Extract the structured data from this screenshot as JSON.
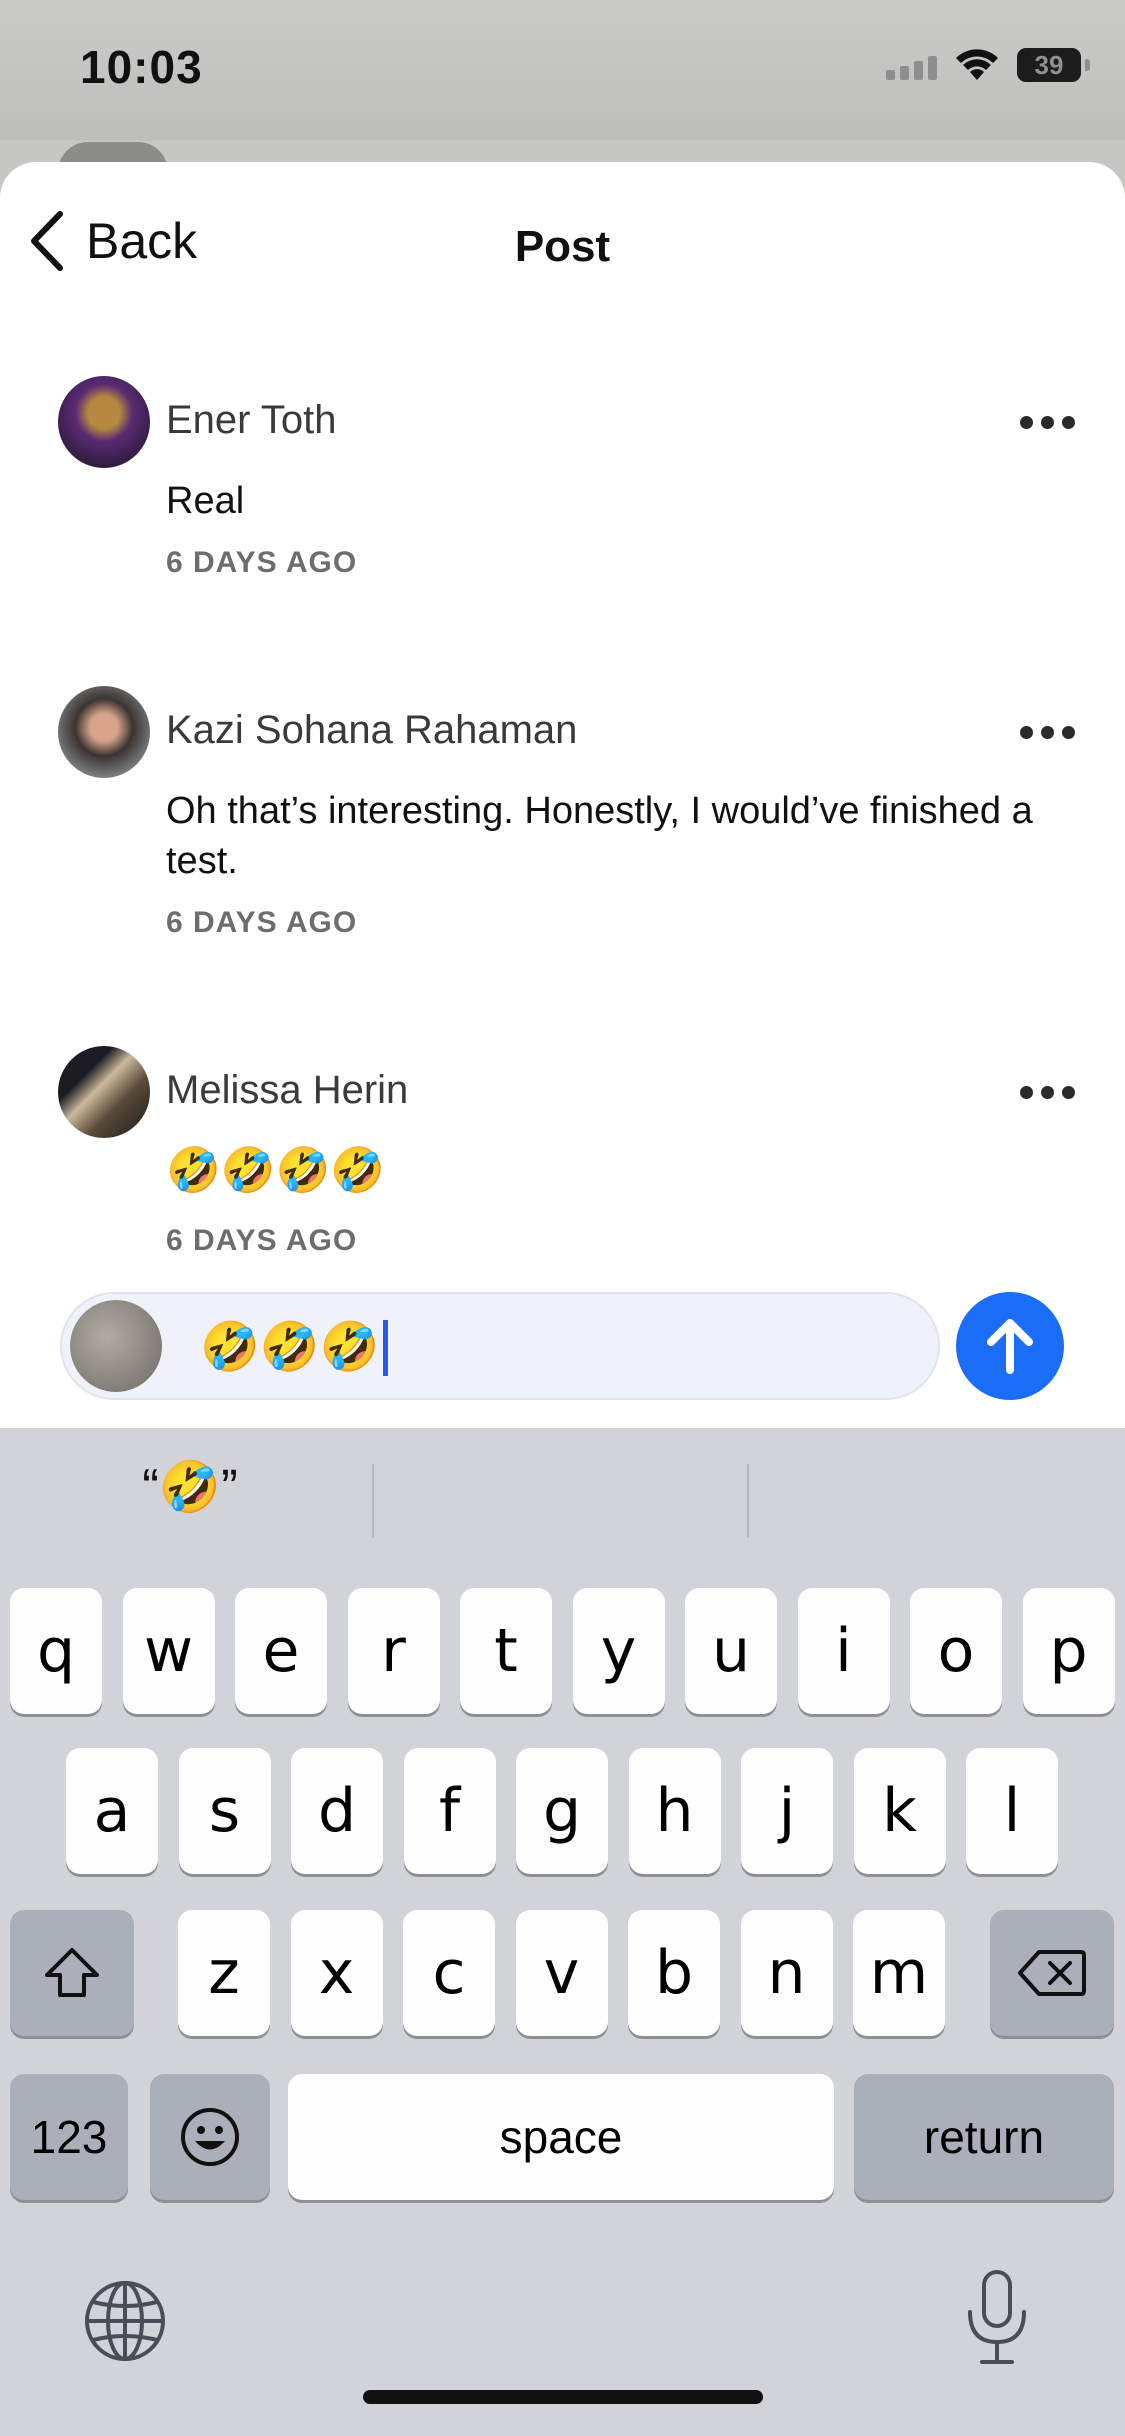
{
  "status_bar": {
    "time": "10:03",
    "battery": "39"
  },
  "nav": {
    "back_label": "Back",
    "title": "Post"
  },
  "comments": [
    {
      "author": "Ener Toth",
      "body": "Real",
      "time": "6 DAYS AGO"
    },
    {
      "author": "Kazi Sohana Rahaman",
      "body": "Oh that’s interesting. Honestly, I would’ve finished a test.",
      "time": "6 DAYS AGO"
    },
    {
      "author": "Melissa Herin",
      "body": "🤣🤣🤣🤣",
      "time": "6 DAYS AGO"
    }
  ],
  "composer": {
    "value": "🤣🤣🤣"
  },
  "keyboard": {
    "suggestion": "“🤣”",
    "row1": [
      "q",
      "w",
      "e",
      "r",
      "t",
      "y",
      "u",
      "i",
      "o",
      "p"
    ],
    "row2": [
      "a",
      "s",
      "d",
      "f",
      "g",
      "h",
      "j",
      "k",
      "l"
    ],
    "row3": [
      "z",
      "x",
      "c",
      "v",
      "b",
      "n",
      "m"
    ],
    "numbers_label": "123",
    "space_label": "space",
    "return_label": "return"
  },
  "colors": {
    "accent": "#1b6df5",
    "caret": "#2b5ce6",
    "keyboard_bg": "#d1d3d9"
  },
  "icons": [
    "chevron-left-icon",
    "more-icon",
    "arrow-up-icon",
    "shift-icon",
    "backspace-icon",
    "emoji-icon",
    "globe-icon",
    "microphone-icon",
    "wifi-icon",
    "signal-icon",
    "battery-icon"
  ]
}
